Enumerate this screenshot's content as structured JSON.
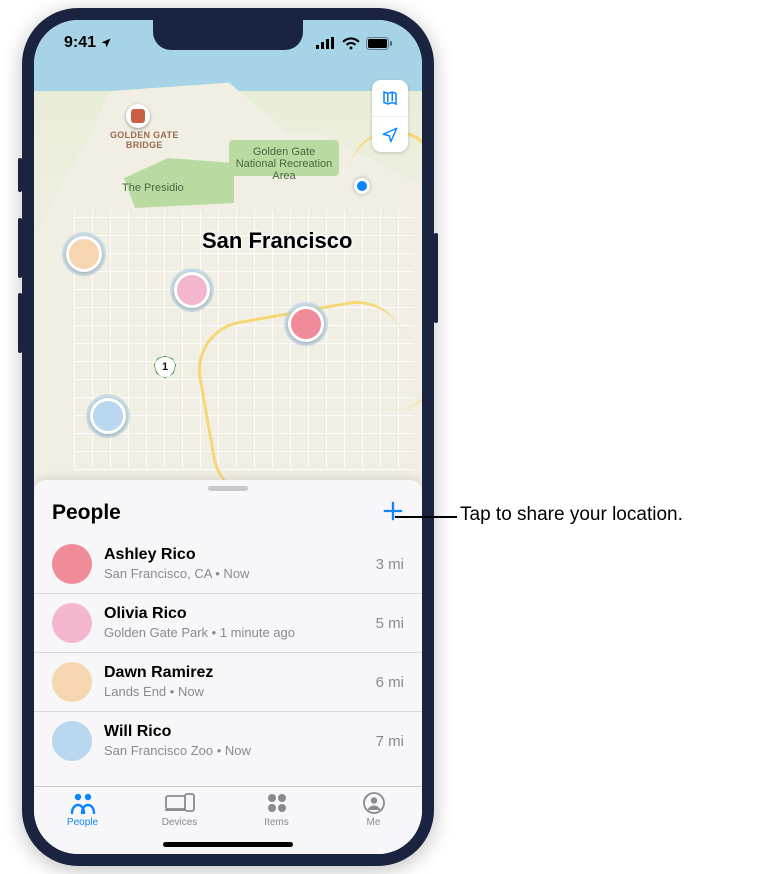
{
  "status_bar": {
    "time": "9:41",
    "location_arrow": "➤"
  },
  "map": {
    "city_label": "San Francisco",
    "landmark_bridge": "GOLDEN GATE\nBRIDGE",
    "park_presidio": "The Presidio",
    "park_ggnra": "Golden Gate\nNational\nRecreation Area",
    "highway_shield": "1"
  },
  "sheet": {
    "title": "People"
  },
  "people": [
    {
      "name": "Ashley Rico",
      "sub": "San Francisco, CA • Now",
      "distance": "3 mi",
      "avatarColor": "#f08c9a"
    },
    {
      "name": "Olivia Rico",
      "sub": "Golden Gate Park • 1 minute ago",
      "distance": "5 mi",
      "avatarColor": "#f2b6cf"
    },
    {
      "name": "Dawn Ramirez",
      "sub": "Lands End • Now",
      "distance": "6 mi",
      "avatarColor": "#f5d6b1"
    },
    {
      "name": "Will Rico",
      "sub": "San Francisco Zoo • Now",
      "distance": "7 mi",
      "avatarColor": "#b9d8ef"
    }
  ],
  "tabs": [
    {
      "label": "People",
      "active": true
    },
    {
      "label": "Devices",
      "active": false
    },
    {
      "label": "Items",
      "active": false
    },
    {
      "label": "Me",
      "active": false
    }
  ],
  "callout": {
    "text": "Tap to share your location."
  }
}
